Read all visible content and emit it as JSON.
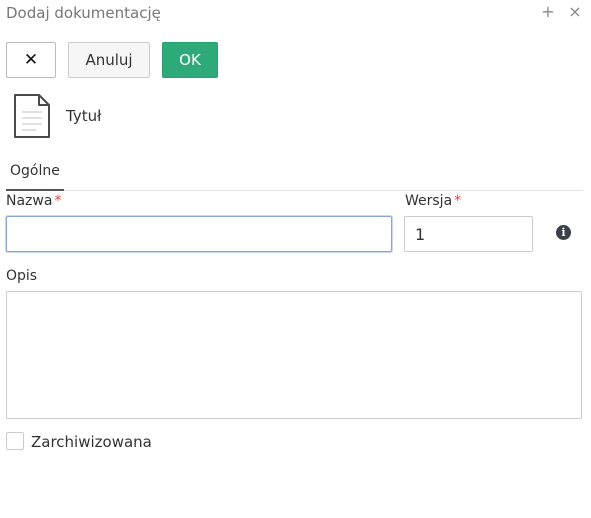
{
  "dialog": {
    "title": "Dodaj dokumentację",
    "add_icon": "+",
    "close_icon": "×"
  },
  "toolbar": {
    "close_label": "✕",
    "cancel_label": "Anuluj",
    "ok_label": "OK"
  },
  "document": {
    "icon": "document-icon",
    "title": "Tytuł"
  },
  "tabs": [
    {
      "label": "Ogólne",
      "active": true
    }
  ],
  "form": {
    "name": {
      "label": "Nazwa",
      "required": "*",
      "value": ""
    },
    "version": {
      "label": "Wersja",
      "required": "*",
      "value": "1",
      "info_icon": "i"
    },
    "description": {
      "label": "Opis",
      "value": ""
    },
    "archived": {
      "label": "Zarchiwizowana",
      "checked": false
    }
  },
  "colors": {
    "ok_button": "#2eaa7a",
    "required_marker": "#e0463f",
    "focus_border": "#8aa4d8"
  }
}
